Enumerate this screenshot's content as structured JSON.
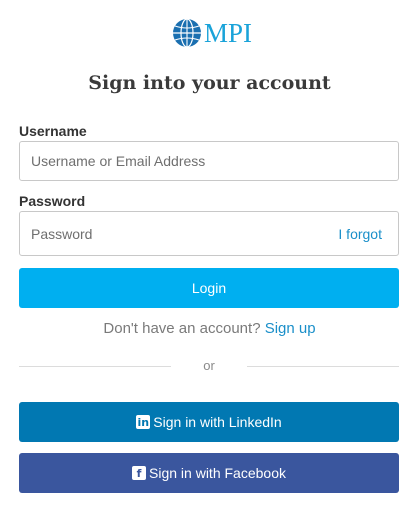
{
  "logo": {
    "text": "MPI"
  },
  "title": "Sign into your account",
  "username": {
    "label": "Username",
    "placeholder": "Username or Email Address",
    "value": ""
  },
  "password": {
    "label": "Password",
    "placeholder": "Password",
    "value": "",
    "forgot_label": "I forgot"
  },
  "login_label": "Login",
  "signup": {
    "prompt": "Don't have an account?",
    "link": "Sign up"
  },
  "divider_text": "or",
  "linkedin": {
    "icon": "linkedin-icon",
    "icon_glyph": "in",
    "label": "Sign in with LinkedIn"
  },
  "facebook": {
    "icon": "facebook-icon",
    "icon_glyph": "f",
    "label": "Sign in with Facebook"
  },
  "colors": {
    "brand": "#1aa3d9",
    "login_button": "#00aff0",
    "linkedin_button": "#0178b2",
    "facebook_button": "#3a569e",
    "link": "#1a8fc9"
  }
}
